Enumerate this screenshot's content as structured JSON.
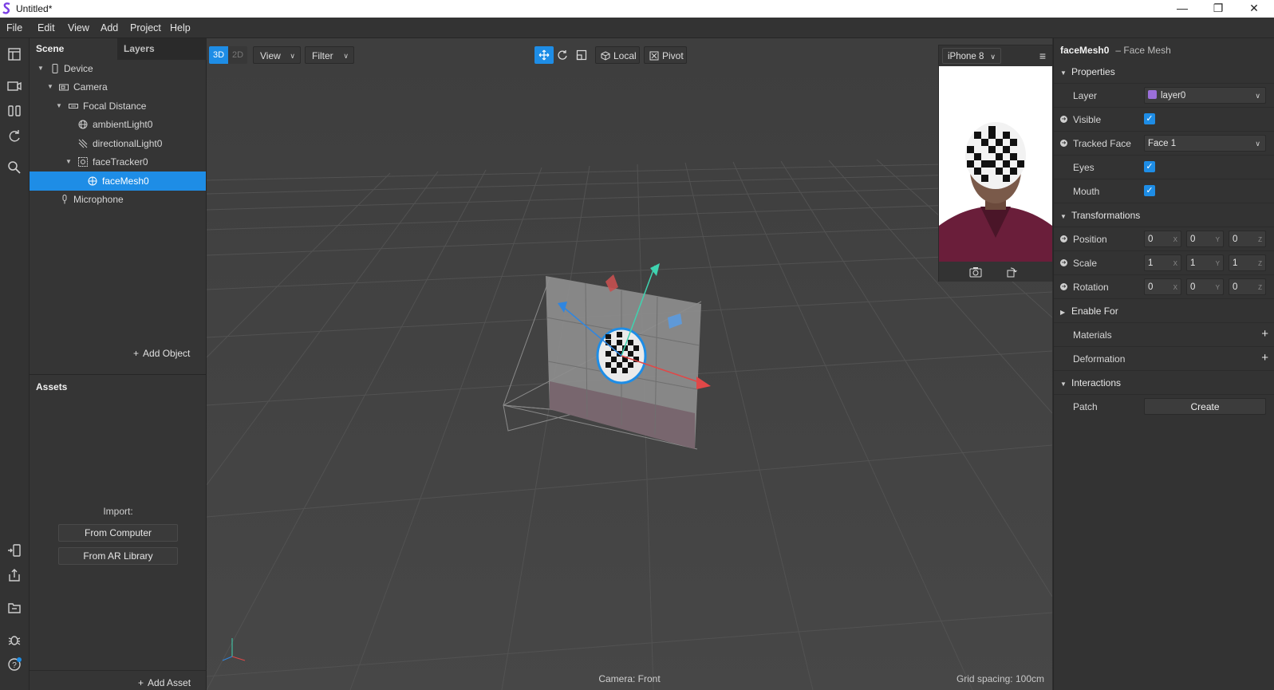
{
  "window": {
    "title": "Untitled*",
    "controls": [
      "—",
      "❐",
      "✕"
    ]
  },
  "menu": [
    "File",
    "Edit",
    "View",
    "Add",
    "Project",
    "Help"
  ],
  "scene_panel": {
    "tabs": [
      "Scene",
      "Layers"
    ],
    "tree": [
      {
        "label": "Device",
        "icon": "device-icon",
        "expanded": true
      },
      {
        "label": "Camera",
        "icon": "camera-icon",
        "expanded": true
      },
      {
        "label": "Focal Distance",
        "icon": "focal-distance-icon",
        "expanded": true
      },
      {
        "label": "ambientLight0",
        "icon": "ambient-light-icon"
      },
      {
        "label": "directionalLight0",
        "icon": "directional-light-icon"
      },
      {
        "label": "faceTracker0",
        "icon": "face-tracker-icon",
        "expanded": true
      },
      {
        "label": "faceMesh0",
        "icon": "face-mesh-icon",
        "selected": true
      },
      {
        "label": "Microphone",
        "icon": "microphone-icon"
      }
    ],
    "add_object": "Add Object"
  },
  "assets_panel": {
    "title": "Assets",
    "import_label": "Import:",
    "buttons": [
      "From Computer",
      "From AR Library"
    ],
    "add_asset": "Add Asset"
  },
  "viewport": {
    "mode_3d": "3D",
    "mode_2d": "2D",
    "view_menu": "View",
    "filter_menu": "Filter",
    "local_label": "Local",
    "pivot_label": "Pivot",
    "camera_label": "Camera: Front",
    "grid_spacing": "Grid spacing: 100cm"
  },
  "preview": {
    "device": "iPhone 8"
  },
  "inspector": {
    "object_name": "faceMesh0",
    "object_type": "– Face Mesh",
    "sections": {
      "properties": "Properties",
      "transformations": "Transformations",
      "enable_for": "Enable For",
      "materials": "Materials",
      "deformation": "Deformation",
      "interactions": "Interactions"
    },
    "layer": {
      "label": "Layer",
      "value": "layer0",
      "swatch_color": "#9b6fd9"
    },
    "visible": {
      "label": "Visible",
      "checked": true
    },
    "tracked_face": {
      "label": "Tracked Face",
      "value": "Face 1"
    },
    "eyes": {
      "label": "Eyes",
      "checked": true
    },
    "mouth": {
      "label": "Mouth",
      "checked": true
    },
    "position": {
      "label": "Position",
      "x": "0",
      "y": "0",
      "z": "0"
    },
    "scale": {
      "label": "Scale",
      "x": "1",
      "y": "1",
      "z": "1"
    },
    "rotation": {
      "label": "Rotation",
      "x": "0",
      "y": "0",
      "z": "0"
    },
    "patch": {
      "label": "Patch",
      "button": "Create"
    },
    "axis_labels": [
      "X",
      "Y",
      "Z"
    ]
  },
  "colors": {
    "accent": "#1e8de6",
    "panel": "#333333",
    "viewport": "#404040"
  }
}
